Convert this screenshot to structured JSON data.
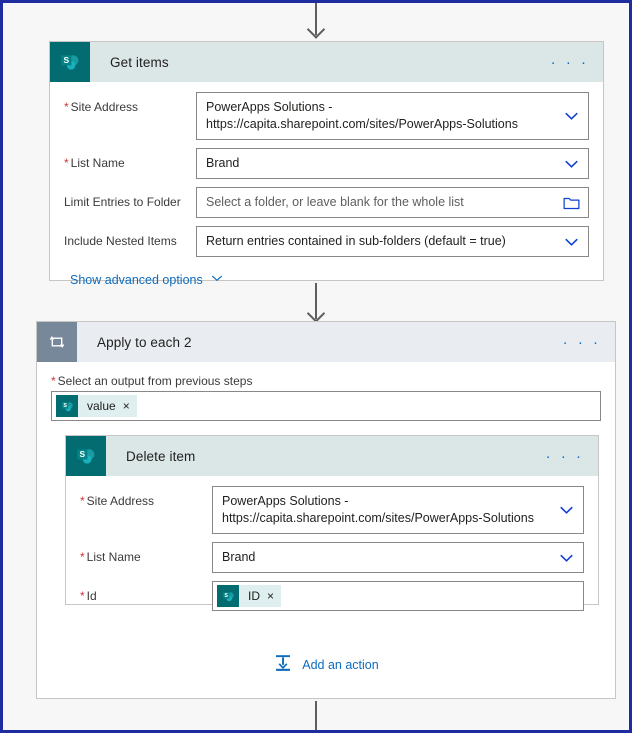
{
  "theme": {
    "frame_border": "#1f2ca0",
    "sharepoint_teal": "#036c70",
    "loop_slate": "#78889b",
    "link_blue": "#0f6cbd",
    "required_red": "#d13438",
    "card_header_teal": "#dae7e6",
    "card_header_gray": "#e9edf1"
  },
  "get_items": {
    "title": "Get items",
    "icon": "sharepoint-icon",
    "menu": "· · ·",
    "fields": [
      {
        "label": "Site Address",
        "required": true,
        "value": "PowerApps Solutions - https://capita.sharepoint.com/sites/PowerApps-Solutions",
        "affix": "chevron-down-icon",
        "placeholder": false
      },
      {
        "label": "List Name",
        "required": true,
        "value": "Brand",
        "affix": "chevron-down-icon",
        "placeholder": false
      },
      {
        "label": "Limit Entries to Folder",
        "required": false,
        "value": "Select a folder, or leave blank for the whole list",
        "affix": "folder-icon",
        "placeholder": true
      },
      {
        "label": "Include Nested Items",
        "required": false,
        "value": "Return entries contained in sub-folders (default = true)",
        "affix": "chevron-down-icon",
        "placeholder": false
      }
    ],
    "advanced_options_label": "Show advanced options"
  },
  "apply_to_each": {
    "title": "Apply to each 2",
    "icon": "loop-icon",
    "menu": "· · ·",
    "output_label": "Select an output from previous steps",
    "output_required": true,
    "output_token": {
      "icon": "sharepoint-icon",
      "text": "value",
      "remove": "×"
    },
    "add_action_label": "Add an action",
    "add_action_icon": "insert-action-icon"
  },
  "delete_item": {
    "title": "Delete item",
    "icon": "sharepoint-icon",
    "menu": "· · ·",
    "fields": [
      {
        "label": "Site Address",
        "required": true,
        "value": "PowerApps Solutions - https://capita.sharepoint.com/sites/PowerApps-Solutions",
        "affix": "chevron-down-icon"
      },
      {
        "label": "List Name",
        "required": true,
        "value": "Brand",
        "affix": "chevron-down-icon"
      }
    ],
    "id_field": {
      "label": "Id",
      "required": true,
      "token": {
        "icon": "sharepoint-icon",
        "text": "ID",
        "remove": "×"
      }
    }
  }
}
